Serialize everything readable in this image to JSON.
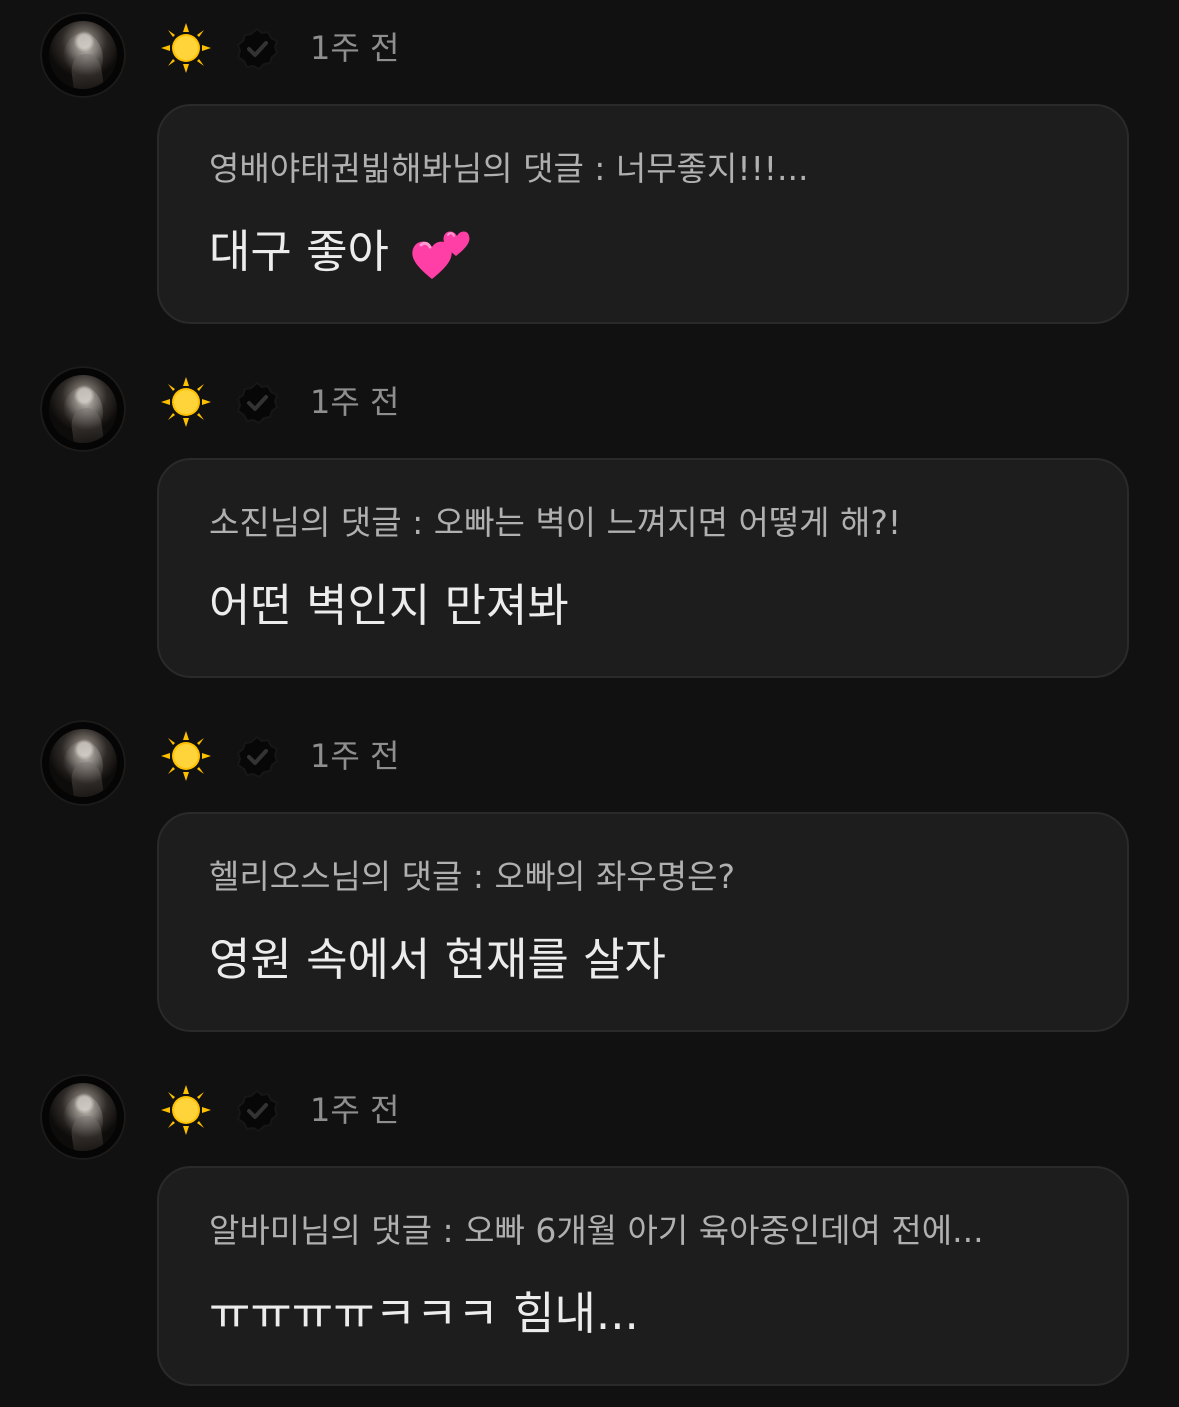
{
  "colors": {
    "background": "#111111",
    "card_background": "#1d1d1d",
    "card_border": "#2a2a2a",
    "muted_text": "#8e8e8e",
    "quoted_text": "#b0b0b0",
    "primary_text": "#ececec",
    "sun": "#ffc000",
    "verified_badge": "#070707"
  },
  "posts": [
    {
      "author_emoji_icon": "sun-icon",
      "badge_icon": "verified-icon",
      "time": "1주 전",
      "quoted_comment": "영배야태권빎해봐님의 댓글 : 너무좋지!!!...",
      "reply": "대구 좋아",
      "reply_emoji_icon": "two-hearts-icon"
    },
    {
      "author_emoji_icon": "sun-icon",
      "badge_icon": "verified-icon",
      "time": "1주 전",
      "quoted_comment": "소진님의 댓글 : 오빠는 벽이 느껴지면 어떻게 해?!",
      "reply": "어떤 벽인지 만져봐"
    },
    {
      "author_emoji_icon": "sun-icon",
      "badge_icon": "verified-icon",
      "time": "1주 전",
      "quoted_comment": "헬리오스님의 댓글 : 오빠의 좌우명은?",
      "reply": "영원 속에서 현재를 살자"
    },
    {
      "author_emoji_icon": "sun-icon",
      "badge_icon": "verified-icon",
      "time": "1주 전",
      "quoted_comment": "알바미님의 댓글 : 오빠 6개월 아기 육아중인데여 전에...",
      "reply": "ㅠㅠㅠㅠㅋㅋㅋ 힘내..."
    }
  ]
}
